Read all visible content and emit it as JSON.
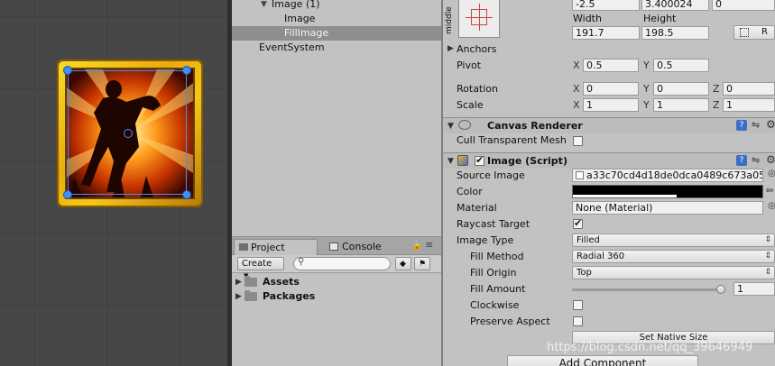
{
  "hierarchy": {
    "items": [
      {
        "label": "Image (1)"
      },
      {
        "label": "Image"
      },
      {
        "label": "FillImage"
      },
      {
        "label": "EventSystem"
      }
    ]
  },
  "project": {
    "tabs": [
      {
        "label": "Project"
      },
      {
        "label": "Console"
      }
    ],
    "create_label": "Create",
    "folders": [
      {
        "label": "Assets"
      },
      {
        "label": "Packages"
      }
    ]
  },
  "rect_transform": {
    "anchor_preset": "middle",
    "top_values": [
      "-2.5",
      "3.400024",
      "0"
    ],
    "width_label": "Width",
    "height_label": "Height",
    "width": "191.7",
    "height": "198.5",
    "anchors_label": "Anchors",
    "pivot_label": "Pivot",
    "pivot_x": "0.5",
    "pivot_y": "0.5",
    "rotation_label": "Rotation",
    "rotation": [
      "0",
      "0",
      "0"
    ],
    "scale_label": "Scale",
    "scale": [
      "1",
      "1",
      "1"
    ],
    "axis_x": "X",
    "axis_y": "Y",
    "axis_z": "Z"
  },
  "canvas_renderer": {
    "title": "Canvas Renderer",
    "cull_label": "Cull Transparent Mesh"
  },
  "image_script": {
    "title": "Image (Script)",
    "source_image_label": "Source Image",
    "source_image_value": "a33c70cd4d18de0dca0489c673a05",
    "color_label": "Color",
    "material_label": "Material",
    "material_value": "None (Material)",
    "raycast_label": "Raycast Target",
    "image_type_label": "Image Type",
    "image_type_value": "Filled",
    "fill_method_label": "Fill Method",
    "fill_method_value": "Radial 360",
    "fill_origin_label": "Fill Origin",
    "fill_origin_value": "Top",
    "fill_amount_label": "Fill Amount",
    "fill_amount_value": "1",
    "fill_amount_fraction": 1,
    "clockwise_label": "Clockwise",
    "preserve_label": "Preserve Aspect",
    "native_size_label": "Set Native Size",
    "add_component_label": "Add Component"
  },
  "watermark": "https://blog.csdn.net/qq_39646949",
  "colors": {
    "selection": "#8e8e8e",
    "handle": "#3f8ef5",
    "frame_gold": "#f3c919",
    "inspector_bg": "#c2c2c2"
  }
}
